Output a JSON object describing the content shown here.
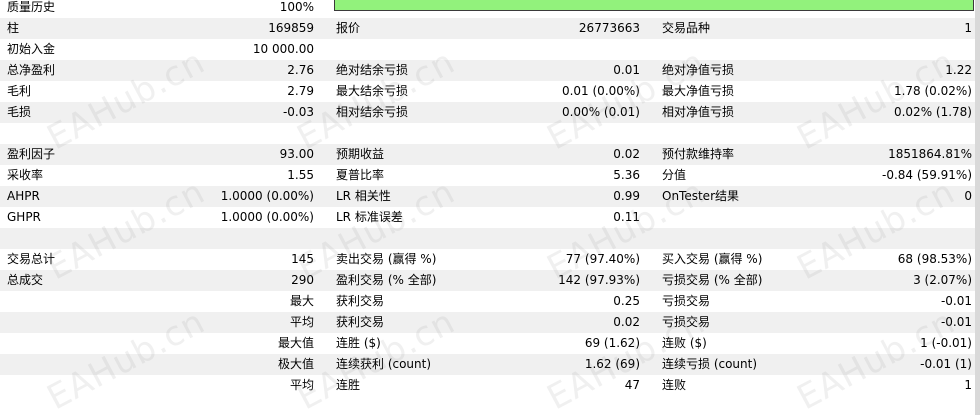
{
  "history_quality": {
    "label": "质量历史",
    "value": "100%",
    "fill_fraction": 1.0,
    "bar_color": "#92f27c"
  },
  "rows": [
    [
      "柱",
      "169859",
      "报价",
      "26773663",
      "交易品种",
      "1"
    ],
    [
      "初始入金",
      "10 000.00",
      "",
      "",
      "",
      ""
    ],
    [
      "总净盈利",
      "2.76",
      "绝对结余亏损",
      "0.01",
      "绝对净值亏损",
      "1.22"
    ],
    [
      "毛利",
      "2.79",
      "最大结余亏损",
      "0.01 (0.00%)",
      "最大净值亏损",
      "1.78 (0.02%)"
    ],
    [
      "毛损",
      "-0.03",
      "相对结余亏损",
      "0.00% (0.01)",
      "相对净值亏损",
      "0.02% (1.78)"
    ],
    [
      "",
      "",
      "",
      "",
      "",
      ""
    ],
    [
      "盈利因子",
      "93.00",
      "预期收益",
      "0.02",
      "预付款维持率",
      "1851864.81%"
    ],
    [
      "采收率",
      "1.55",
      "夏普比率",
      "5.36",
      "分值",
      "-0.84 (59.91%)"
    ],
    [
      "AHPR",
      "1.0000 (0.00%)",
      "LR 相关性",
      "0.99",
      "OnTester结果",
      "0"
    ],
    [
      "GHPR",
      "1.0000 (0.00%)",
      "LR 标准误差",
      "0.11",
      "",
      ""
    ],
    [
      "",
      "",
      "",
      "",
      "",
      ""
    ],
    [
      "交易总计",
      "145",
      "卖出交易 (赢得 %)",
      "77 (97.40%)",
      "买入交易 (赢得 %)",
      "68 (98.53%)"
    ],
    [
      "总成交",
      "290",
      "盈利交易 (% 全部)",
      "142 (97.93%)",
      "亏损交易 (% 全部)",
      "3 (2.07%)"
    ],
    [
      "",
      "最大",
      "获利交易",
      "0.25",
      "亏损交易",
      "-0.01"
    ],
    [
      "",
      "平均",
      "获利交易",
      "0.02",
      "亏损交易",
      "-0.01"
    ],
    [
      "",
      "最大值",
      "连胜 ($)",
      "69 (1.62)",
      "连败 ($)",
      "1 (-0.01)"
    ],
    [
      "",
      "极大值",
      "连续获利 (count)",
      "1.62 (69)",
      "连续亏损 (count)",
      "-0.01 (1)"
    ],
    [
      "",
      "平均",
      "连胜",
      "47",
      "连败",
      "1"
    ]
  ],
  "watermark": {
    "text": "EAHub.cn"
  }
}
